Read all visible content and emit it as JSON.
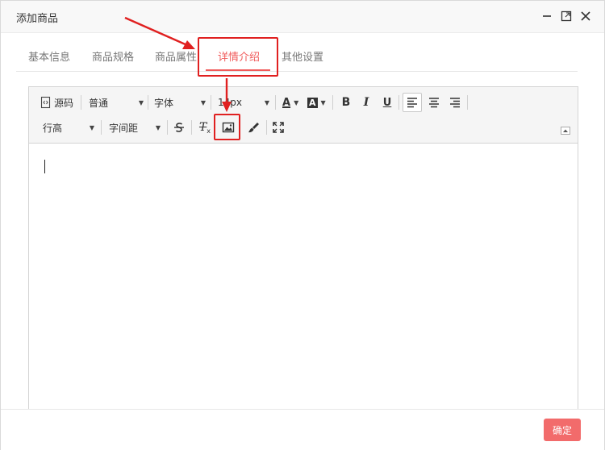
{
  "dialog": {
    "title": "添加商品"
  },
  "window_controls": {
    "minimize": "minimize-icon",
    "maximize": "maximize-icon",
    "close": "close-icon"
  },
  "tabs": [
    {
      "label": "基本信息",
      "active": false
    },
    {
      "label": "商品规格",
      "active": false
    },
    {
      "label": "商品属性",
      "active": false
    },
    {
      "label": "详情介绍",
      "active": true
    },
    {
      "label": "其他设置",
      "active": false
    }
  ],
  "toolbar": {
    "source_label": "源码",
    "paragraph_value": "普通",
    "font_value": "字体",
    "font_size_value": "14px",
    "line_height_value": "行高",
    "letter_spacing_value": "字间距",
    "bold": "B",
    "italic": "I",
    "underline": "U",
    "font_color_letter": "A",
    "bg_color_letter": "A",
    "clear_format_letter": "T"
  },
  "footer": {
    "confirm_label": "确定"
  },
  "colors": {
    "accent": "#f05a5a",
    "confirm_bg": "#f26b6b",
    "annotation_red": "#e02020"
  }
}
